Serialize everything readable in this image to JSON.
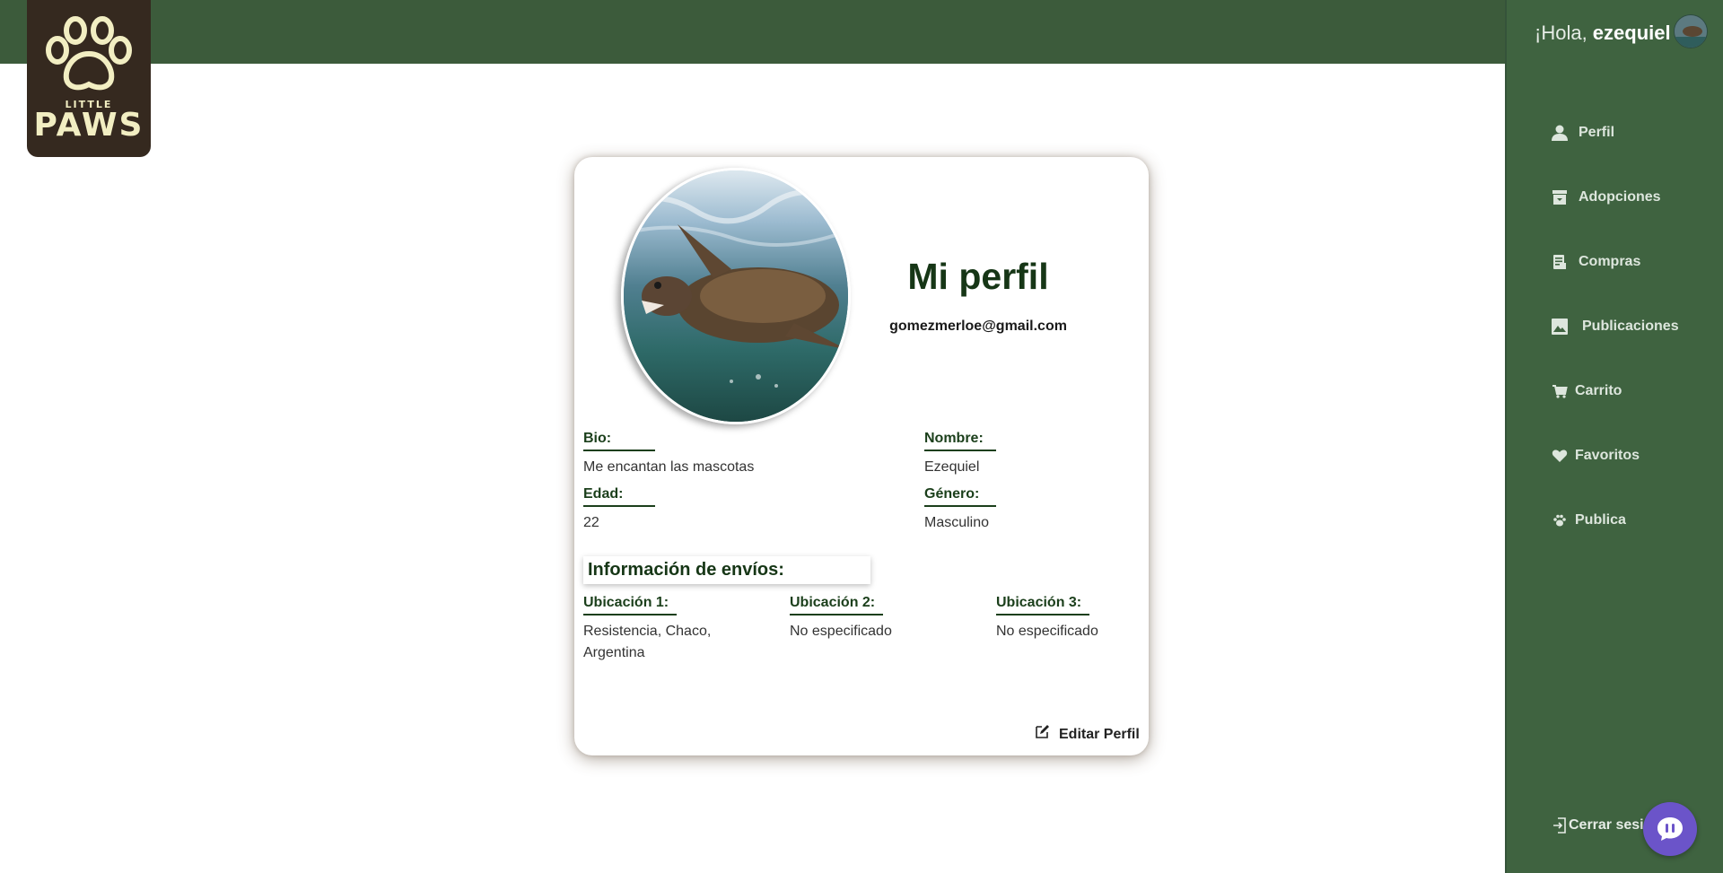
{
  "header": {
    "logo_small": "LITTLE",
    "logo_big": "PAWS"
  },
  "sidebar": {
    "greeting_prefix": "¡Hola, ",
    "greeting_user": "ezequiel",
    "items": [
      {
        "label": "Perfil",
        "icon": "person-icon"
      },
      {
        "label": "Adopciones",
        "icon": "archive-icon"
      },
      {
        "label": "Compras",
        "icon": "receipt-icon"
      },
      {
        "label": "Publicaciones",
        "icon": "image-icon"
      },
      {
        "label": "Carrito",
        "icon": "cart-icon"
      },
      {
        "label": "Favoritos",
        "icon": "heart-icon"
      },
      {
        "label": "Publica",
        "icon": "paw-icon"
      }
    ],
    "logout_label": "Cerrar sesi"
  },
  "profile": {
    "title": "Mi perfil",
    "email": "gomezmerloe@gmail.com",
    "bio_label": "Bio:",
    "bio_value": "Me encantan las mascotas",
    "name_label": "Nombre:",
    "name_value": "Ezequiel",
    "age_label": "Edad:",
    "age_value": "22",
    "gender_label": "Género:",
    "gender_value": "Masculino",
    "shipping_title": "Información de envíos:",
    "locations": [
      {
        "label": "Ubicación 1:",
        "value": "Resistencia, Chaco, Argentina"
      },
      {
        "label": "Ubicación 2:",
        "value": "No especificado"
      },
      {
        "label": "Ubicación 3:",
        "value": "No especificado"
      }
    ],
    "edit_label": "Editar Perfil"
  },
  "colors": {
    "topbar": "#3c5b3b",
    "sidebar": "#3f6340",
    "logo_bg": "#35291f",
    "accent_text": "#163616",
    "chat": "#6b54c9"
  }
}
